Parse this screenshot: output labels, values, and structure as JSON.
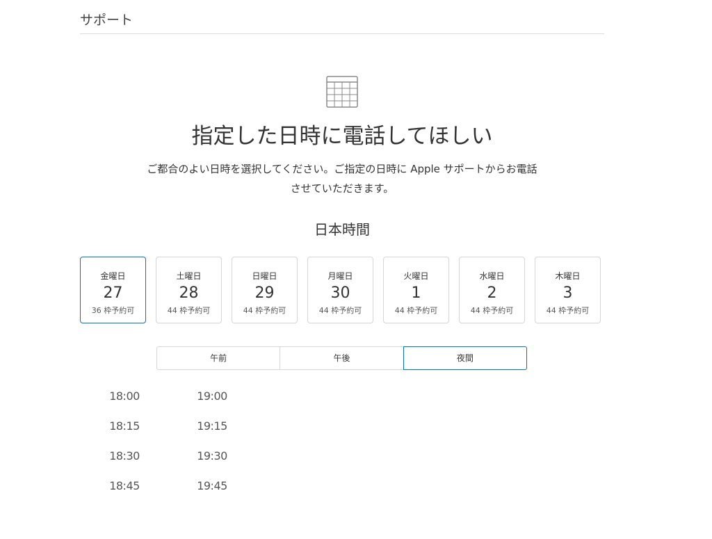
{
  "header": {
    "title": "サポート"
  },
  "icons": {
    "calendar": "calendar-grid-icon"
  },
  "main": {
    "title": "指定した日時に電話してほしい",
    "description_line1": "ご都合のよい日時を選択してください。ご指定の日時に Apple サポートからお電話",
    "description_line2": "させていただきます。",
    "timezone_label": "日本時間"
  },
  "dates": [
    {
      "weekday": "金曜日",
      "day": "27",
      "availability": "36 枠予約可",
      "selected": true
    },
    {
      "weekday": "土曜日",
      "day": "28",
      "availability": "44 枠予約可",
      "selected": false
    },
    {
      "weekday": "日曜日",
      "day": "29",
      "availability": "44 枠予約可",
      "selected": false
    },
    {
      "weekday": "月曜日",
      "day": "30",
      "availability": "44 枠予約可",
      "selected": false
    },
    {
      "weekday": "火曜日",
      "day": "1",
      "availability": "44 枠予約可",
      "selected": false
    },
    {
      "weekday": "水曜日",
      "day": "2",
      "availability": "44 枠予約可",
      "selected": false
    },
    {
      "weekday": "木曜日",
      "day": "3",
      "availability": "44 枠予約可",
      "selected": false
    }
  ],
  "periods": [
    {
      "label": "午前",
      "active": false
    },
    {
      "label": "午後",
      "active": false
    },
    {
      "label": "夜間",
      "active": true
    }
  ],
  "time_slots": {
    "column1": [
      "18:00",
      "18:15",
      "18:30",
      "18:45"
    ],
    "column2": [
      "19:00",
      "19:15",
      "19:30",
      "19:45"
    ]
  },
  "colors": {
    "accent": "#0070c9",
    "border": "#d6d6d6",
    "text": "#333333"
  }
}
